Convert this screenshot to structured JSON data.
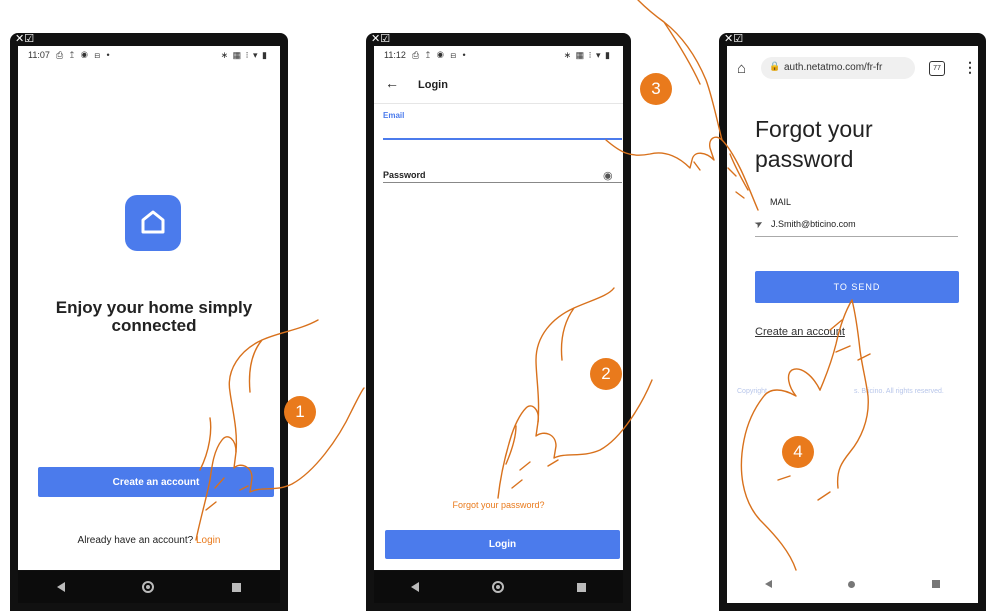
{
  "screen1": {
    "time": "11:07",
    "status_icons": "⎙ ↥ ◉ ⊟ •",
    "status_right": "∗ ▦ ⁝ ▾ ▮",
    "headline": "Enjoy your home simply connected",
    "create_account": "Create an account",
    "already": "Already have an account?",
    "login_link": "Login"
  },
  "screen2": {
    "time": "11:12",
    "status_icons": "⎙ ↥ ◉ ⊟ •",
    "status_right": "∗ ▦ ⁝ ▾ ▮",
    "title": "Login",
    "email_label": "Email",
    "password_label": "Password",
    "forgot": "Forgot your password?",
    "login_button": "Login"
  },
  "screen3": {
    "url": "auth.netatmo.com/fr-fr",
    "tabs_count": "77",
    "heading_line1": "Forgot your",
    "heading_line2": "password",
    "email_label": "MAIL",
    "email_value": "J.Smith@bticino.com",
    "send_button": "TO SEND",
    "create_account": "Create an account",
    "copyright_left": "Copyright",
    "copyright_right": "s. Bticino. All rights reserved."
  },
  "markers": {
    "one": "1",
    "two": "2",
    "three": "3",
    "four": "4"
  },
  "colors": {
    "accent_blue": "#4b7bec",
    "marker_orange": "#e97a1c",
    "hand_stroke": "#d8711c"
  }
}
